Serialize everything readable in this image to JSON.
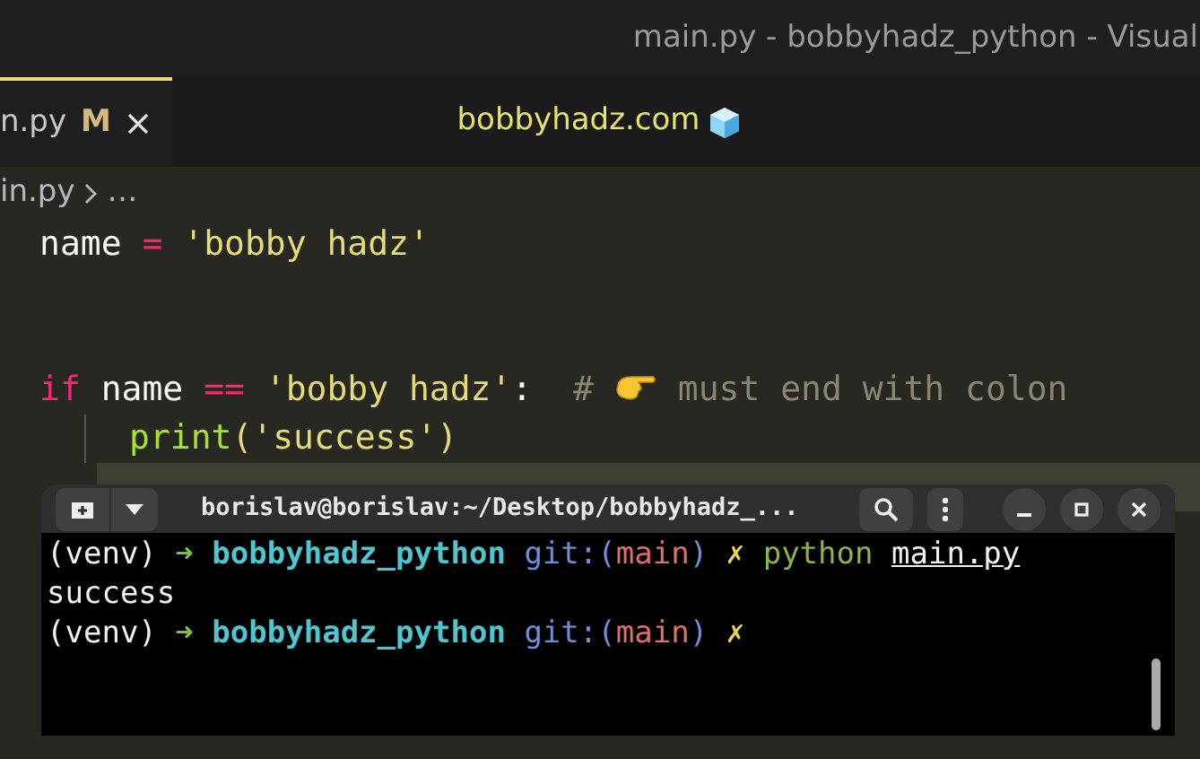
{
  "window": {
    "title": "main.py - bobbyhadz_python - Visual"
  },
  "tabs": [
    {
      "label": "n.py",
      "badge": "M",
      "selected": true
    }
  ],
  "banner": {
    "text": "bobbyhadz.com"
  },
  "breadcrumb": [
    "in.py",
    "…"
  ],
  "code_lines": [
    {
      "indent": false,
      "current": false,
      "tokens": [
        {
          "kind": "name",
          "text": "name"
        },
        {
          "kind": "operator",
          "text": "="
        },
        {
          "kind": "string",
          "text": "'bobby hadz'"
        }
      ]
    },
    {
      "indent": false,
      "current": false
    },
    {
      "indent": false,
      "current": false
    },
    {
      "indent": false,
      "current": false,
      "tokens": [
        {
          "kind": "keyword",
          "text": "if"
        },
        {
          "kind": "name",
          "text": "name"
        },
        {
          "kind": "operator",
          "text": "=="
        },
        {
          "kind": "string",
          "text": "'bobby hadz'"
        },
        {
          "kind": "punct",
          "text": ":"
        },
        {
          "kind": "comment",
          "text": "#"
        },
        {
          "kind": "hand"
        },
        {
          "kind": "comment",
          "text": "must end with colon"
        }
      ]
    },
    {
      "indent": true,
      "current": false,
      "tokens": [
        {
          "kind": "func",
          "text": "print"
        },
        {
          "kind": "paren",
          "text": "("
        },
        {
          "kind": "string",
          "text": "'success'"
        },
        {
          "kind": "paren",
          "text": ")"
        }
      ]
    },
    {
      "indent": true,
      "current": true
    }
  ],
  "terminal": {
    "title": "borislav@borislav:~/Desktop/bobbyhadz_...",
    "lines": [
      [
        {
          "kind": "plain",
          "text": "(venv)"
        },
        {
          "kind": "arrow",
          "text": "➜"
        },
        {
          "kind": "dir",
          "text": "bobbyhadz_python"
        },
        {
          "kind": "git",
          "text": "git:("
        },
        {
          "kind": "branch",
          "text": "main"
        },
        {
          "kind": "git",
          "text": ")"
        },
        {
          "kind": "dirty",
          "text": "✗"
        },
        {
          "kind": "command",
          "text": "python"
        },
        {
          "kind": "arg",
          "text": "main.py"
        }
      ],
      [
        {
          "kind": "plain",
          "text": "success"
        }
      ],
      [
        {
          "kind": "plain",
          "text": "(venv)"
        },
        {
          "kind": "arrow",
          "text": "➜"
        },
        {
          "kind": "dir",
          "text": "bobbyhadz_python"
        },
        {
          "kind": "git",
          "text": "git:("
        },
        {
          "kind": "branch",
          "text": "main"
        },
        {
          "kind": "git",
          "text": ")"
        },
        {
          "kind": "dirty",
          "text": "✗"
        }
      ]
    ]
  }
}
